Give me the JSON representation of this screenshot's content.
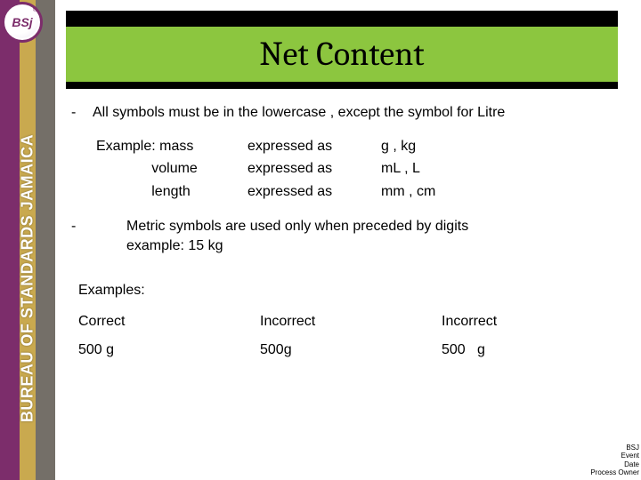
{
  "brand": {
    "vertical": "BUREAU OF STANDARDS JAMAICA",
    "badge": "BSj",
    "badge_r": "®"
  },
  "title": "Net Content",
  "bullets": {
    "b1_dash": "-",
    "b1_text": "All symbols must be in the lowercase , except the symbol for Litre",
    "b2_dash": "-",
    "b2_line1": "Metric symbols are used only when preceded by digits",
    "b2_line2": "example: 15 kg"
  },
  "example": {
    "rows": [
      {
        "c1": "Example: mass",
        "c2": "expressed as",
        "c3": "g , kg"
      },
      {
        "c1": "              volume",
        "c2": "expressed as",
        "c3": "mL , L"
      },
      {
        "c1": "              length",
        "c2": "expressed as",
        "c3": "mm , cm"
      }
    ]
  },
  "examples_table": {
    "label": "Examples:",
    "headers": [
      "Correct",
      "Incorrect",
      "Incorrect"
    ],
    "row": [
      "500 g",
      "500g",
      "500   g"
    ]
  },
  "footer": {
    "l1": "BSJ",
    "l2": "Event",
    "l3": "Date",
    "l4": "Process Owner"
  }
}
